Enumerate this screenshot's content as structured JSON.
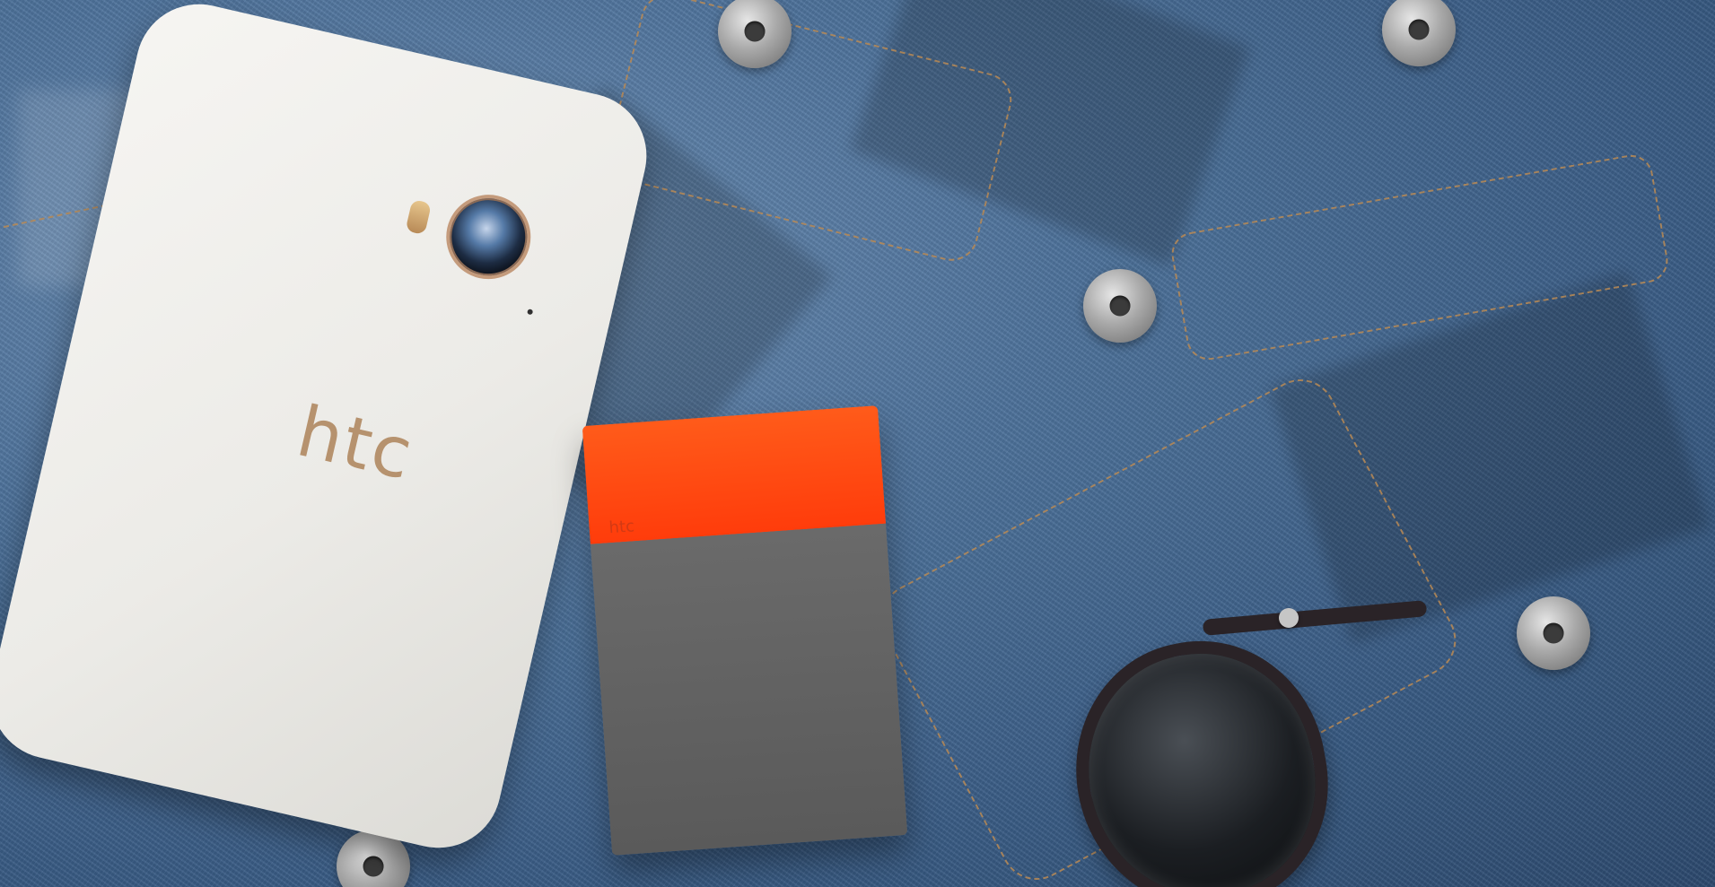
{
  "phone": {
    "brand": "htc"
  },
  "battery": {
    "brand": "htc"
  },
  "colors": {
    "denim": "#3d5f86",
    "phone": "#f0efeb",
    "phone_accent": "#b6926e",
    "battery_top": "#ff3c0b",
    "battery_body": "#5f5f5f",
    "sunglasses_frame": "#2a2327"
  }
}
